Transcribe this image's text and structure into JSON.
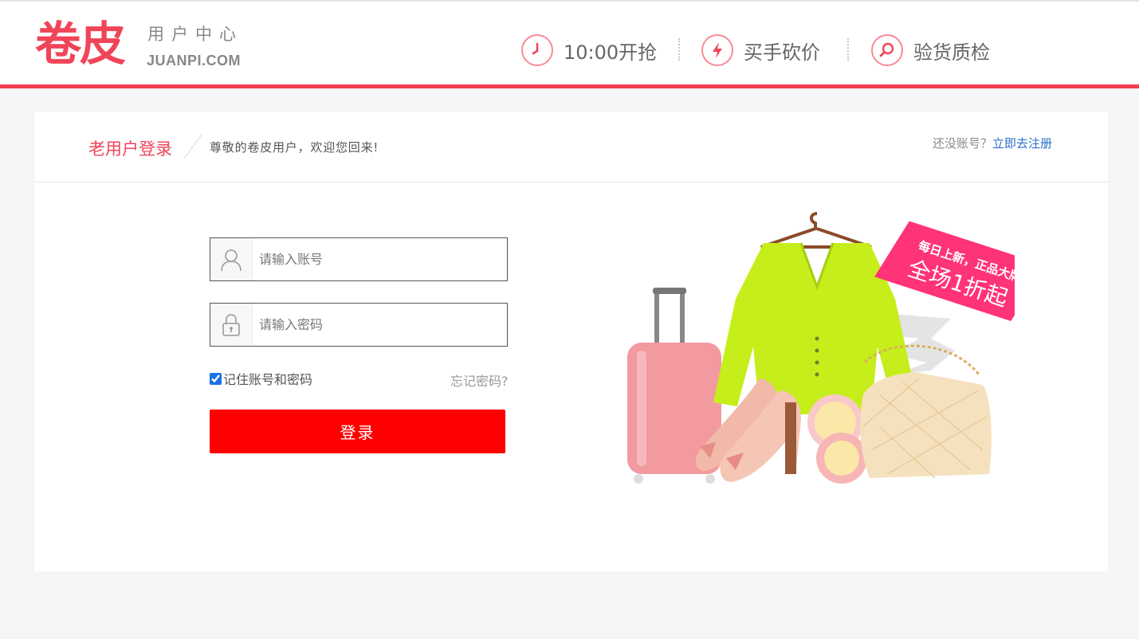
{
  "header": {
    "logo_text": "卷皮",
    "logo_subtitle": "用户中心",
    "logo_domain": "JUANPI.COM",
    "features": [
      {
        "label": "10:00开抢",
        "icon": "clock-icon"
      },
      {
        "label": "买手砍价",
        "icon": "lightning-icon"
      },
      {
        "label": "验货质检",
        "icon": "magnifier-icon"
      }
    ],
    "accent_color": "#f03e4e"
  },
  "login_panel": {
    "title": "老用户登录",
    "welcome": "尊敬的卷皮用户，欢迎您回来!",
    "register_prompt": "还没账号？",
    "register_link": "立即去注册",
    "account_placeholder": "请输入账号",
    "password_placeholder": "请输入密码",
    "remember_label": "记住账号和密码",
    "remember_checked": true,
    "forgot_label": "忘记密码?",
    "submit_label": "登录",
    "submit_color": "#ff0000"
  },
  "promo": {
    "ribbon_line1": "每日上新，正品大牌",
    "ribbon_line2": "全场1折起",
    "ribbon_color": "#ff3377"
  }
}
